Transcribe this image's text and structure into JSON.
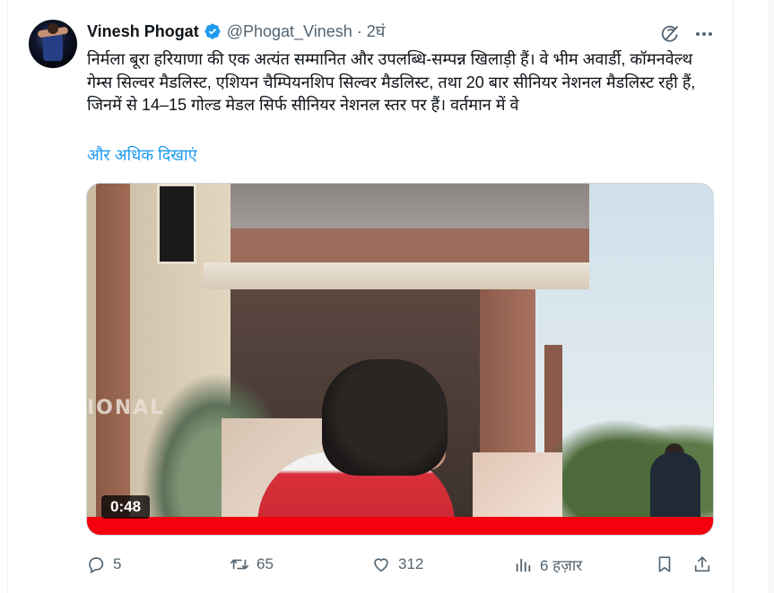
{
  "tweet": {
    "author_name": "Vinesh Phogat",
    "author_handle": "@Phogat_Vinesh",
    "separator": "·",
    "time": "2घं",
    "text": "निर्मला बूरा हरियाणा की एक अत्यंत सम्मानित और उपलब्धि-सम्पन्न खिलाड़ी हैं। वे भीम अवार्डी, कॉमनवेल्थ गेम्स सिल्वर मैडलिस्ट, एशियन चैम्पियनशिप सिल्वर मैडलिस्ट, तथा 20 बार सीनियर नेशनल मैडलिस्ट रही हैं, जिनमें से 14–15 गोल्ड मेडल सिर्फ सीनियर नेशनल स्तर पर हैं। वर्तमान में वे",
    "show_more": "और अधिक दिखाएं"
  },
  "media": {
    "duration": "0:48",
    "progress": 1.0,
    "sign_text": "IONAL"
  },
  "actions": {
    "replies": "5",
    "reposts": "65",
    "likes": "312",
    "views": "6 हज़ार"
  },
  "colors": {
    "accent": "#1d9bf0",
    "muted": "#536471",
    "progress": "#f4000e"
  },
  "icons": [
    "verified-badge-icon",
    "grok-icon",
    "more-icon",
    "reply-icon",
    "repost-icon",
    "like-icon",
    "views-icon",
    "bookmark-icon",
    "share-icon"
  ]
}
